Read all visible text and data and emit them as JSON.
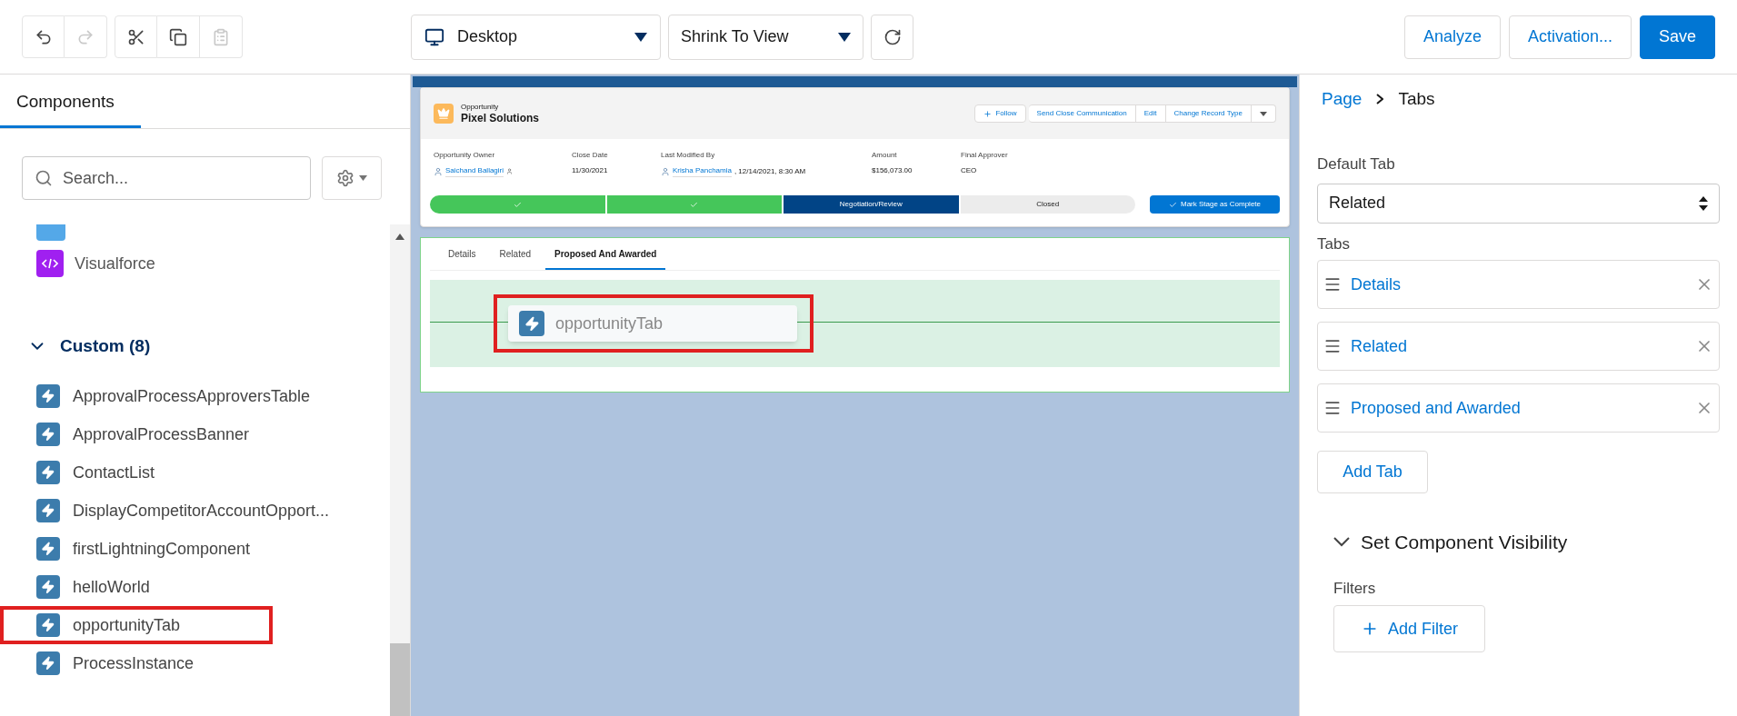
{
  "toolbar": {
    "history": [
      {
        "kind": "undo",
        "disabled": false
      },
      {
        "kind": "redo",
        "disabled": true
      }
    ],
    "clipboard": [
      {
        "kind": "cut",
        "disabled": false
      },
      {
        "kind": "copy",
        "disabled": false
      },
      {
        "kind": "paste",
        "disabled": true
      }
    ],
    "device": "Desktop",
    "zoom": "Shrink To View",
    "actions": [
      {
        "label": "Analyze",
        "primary": false
      },
      {
        "label": "Activation...",
        "primary": false
      },
      {
        "label": "Save",
        "primary": true
      }
    ]
  },
  "left_panel": {
    "tab": "Components",
    "search": {
      "placeholder": "Search..."
    },
    "standard_items": [
      {
        "label": "Visualforce",
        "kind": "visualforce",
        "highlighted": false
      }
    ],
    "custom": {
      "title": "Custom (8)",
      "expanded": true,
      "items": [
        {
          "label": "ApprovalProcessApproversTable",
          "highlighted": false
        },
        {
          "label": "ApprovalProcessBanner",
          "highlighted": false
        },
        {
          "label": "ContactList",
          "highlighted": false
        },
        {
          "label": "DisplayCompetitorAccountOpport...",
          "highlighted": false
        },
        {
          "label": "firstLightningComponent",
          "highlighted": false
        },
        {
          "label": "helloWorld",
          "highlighted": false
        },
        {
          "label": "opportunityTab",
          "highlighted": true
        },
        {
          "label": "ProcessInstance",
          "highlighted": false
        }
      ]
    }
  },
  "canvas": {
    "record": {
      "object": "Opportunity",
      "name": "Pixel Solutions",
      "buttons": [
        {
          "label": "Follow",
          "kind": "follow"
        },
        {
          "label": "Send Close Communication",
          "kind": "text"
        },
        {
          "label": "Edit",
          "kind": "text"
        },
        {
          "label": "Change Record Type",
          "kind": "text"
        },
        {
          "kind": "menu"
        }
      ],
      "fields": [
        {
          "label": "Opportunity Owner",
          "value": "Saichand Ballagiri",
          "kind": "user"
        },
        {
          "label": "Close Date",
          "value": "11/30/2021",
          "kind": "text"
        },
        {
          "label": "Last Modified By",
          "value": "Krisha Panchamia",
          "extra": ", 12/14/2021, 8:30 AM",
          "kind": "user"
        },
        {
          "label": "Amount",
          "value": "$156,073.00",
          "kind": "text"
        },
        {
          "label": "Final Approver",
          "value": "CEO",
          "kind": "text"
        }
      ],
      "stages": [
        {
          "complete": true,
          "current": false
        },
        {
          "complete": true,
          "current": false
        },
        {
          "label": "Negotiation/Review",
          "complete": false,
          "current": true
        },
        {
          "label": "Closed",
          "complete": false,
          "current": false
        }
      ],
      "stage_button": "Mark Stage as Complete"
    },
    "tabs": [
      {
        "label": "Details",
        "selected": false
      },
      {
        "label": "Related",
        "selected": false
      },
      {
        "label": "Proposed And Awarded",
        "selected": true
      }
    ],
    "drop_component": {
      "label": "opportunityTab",
      "highlighted": true
    }
  },
  "right_panel": {
    "breadcrumb": [
      "Page",
      "Tabs"
    ],
    "default_tab": {
      "label": "Default Tab",
      "value": "Related"
    },
    "tabs_label": "Tabs",
    "tabs": [
      {
        "label": "Details"
      },
      {
        "label": "Related"
      },
      {
        "label": "Proposed and Awarded"
      }
    ],
    "add_tab": "Add Tab",
    "visibility": {
      "title": "Set Component Visibility",
      "expanded": true,
      "filters_label": "Filters",
      "add_filter": "Add Filter"
    }
  }
}
